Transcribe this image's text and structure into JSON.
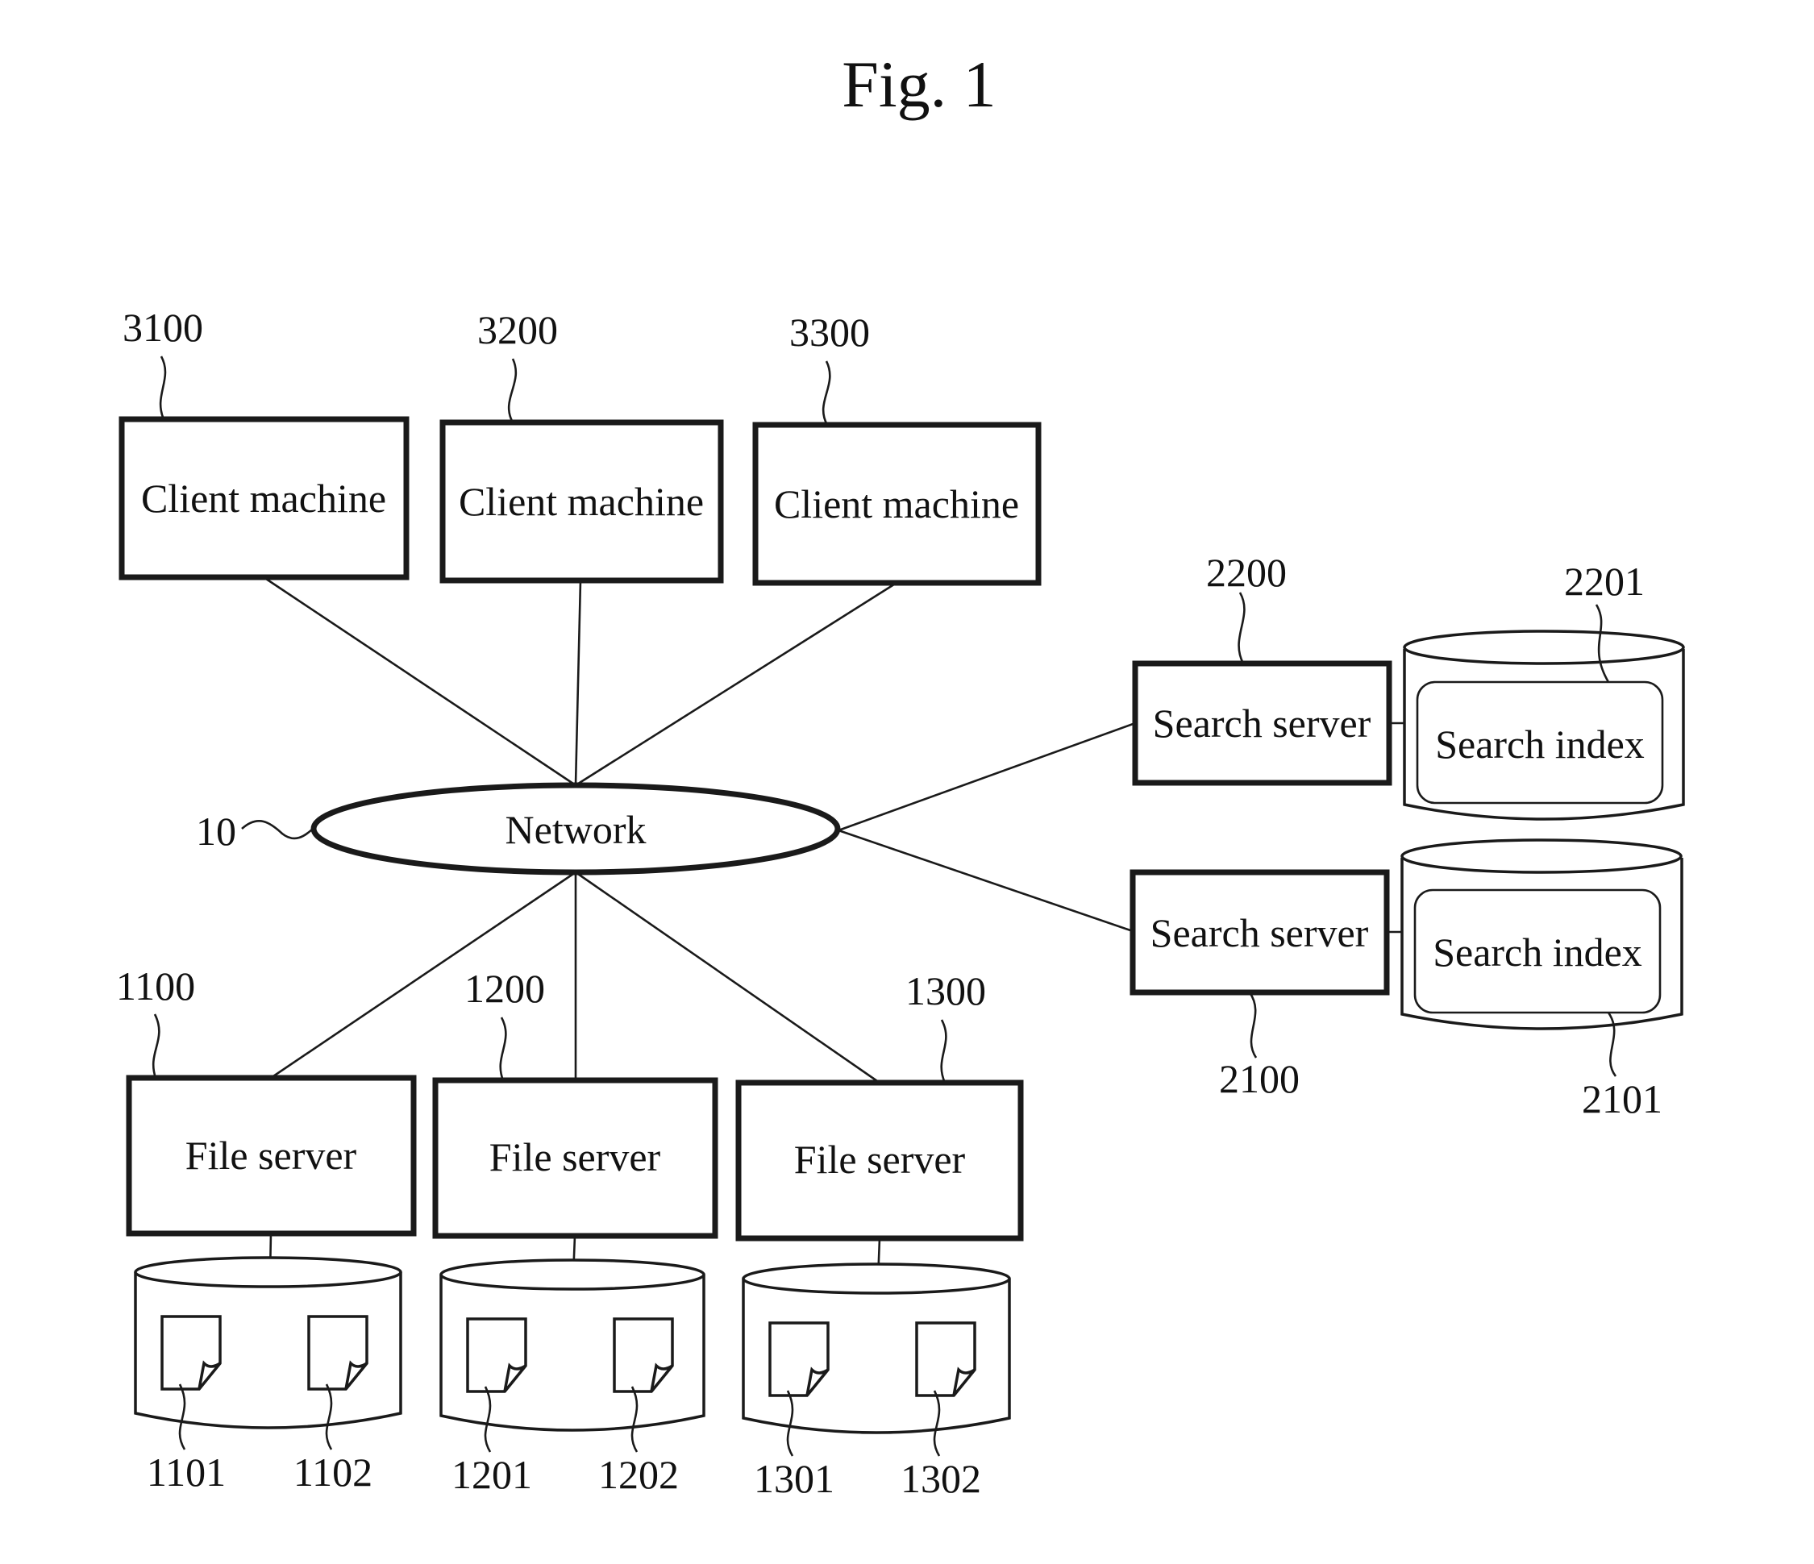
{
  "figure": {
    "title": "Fig. 1",
    "network": {
      "ref": "10",
      "label": "Network"
    },
    "clients": [
      {
        "ref": "3100",
        "label": "Client machine"
      },
      {
        "ref": "3200",
        "label": "Client machine"
      },
      {
        "ref": "3300",
        "label": "Client machine"
      }
    ],
    "search_servers": [
      {
        "ref": "2200",
        "label": "Search server",
        "index_ref": "2201",
        "index_label": "Search index"
      },
      {
        "ref": "2100",
        "label": "Search server",
        "index_ref": "2101",
        "index_label": "Search index"
      }
    ],
    "file_servers": [
      {
        "ref": "1100",
        "label": "File server",
        "files": [
          "1101",
          "1102"
        ]
      },
      {
        "ref": "1200",
        "label": "File server",
        "files": [
          "1201",
          "1202"
        ]
      },
      {
        "ref": "1300",
        "label": "File server",
        "files": [
          "1301",
          "1302"
        ]
      }
    ]
  }
}
